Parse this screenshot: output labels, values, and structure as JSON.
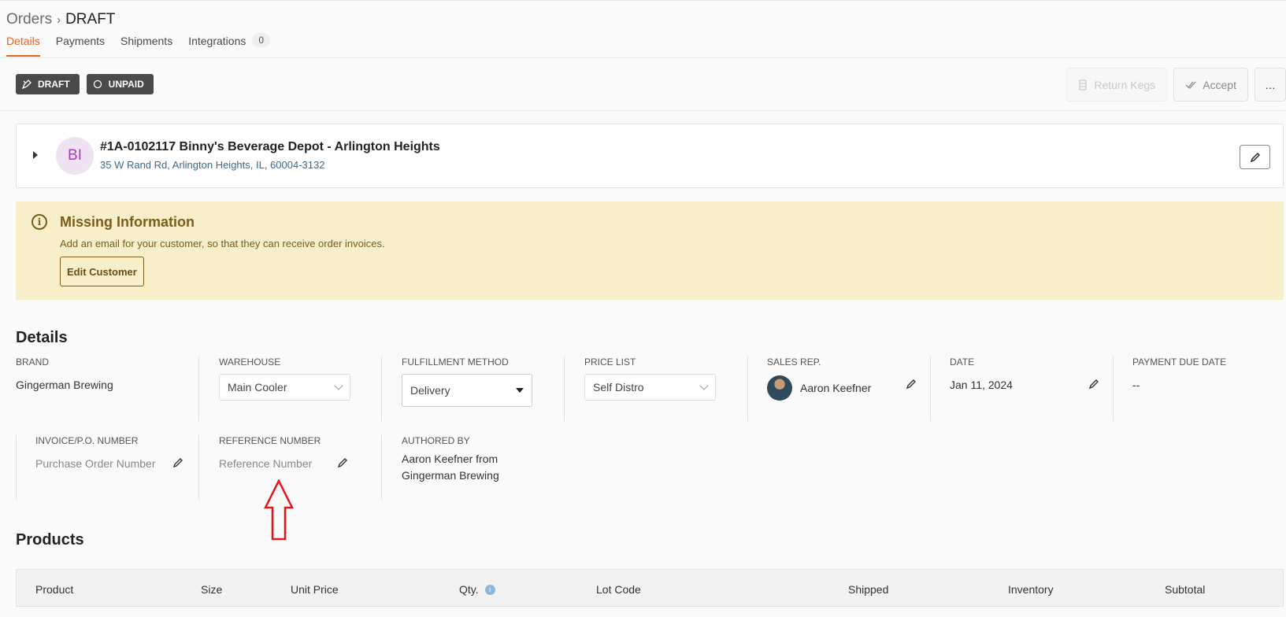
{
  "breadcrumb": {
    "parent": "Orders",
    "separator": "›",
    "current": "DRAFT"
  },
  "tabs": [
    {
      "label": "Details",
      "active": true
    },
    {
      "label": "Payments"
    },
    {
      "label": "Shipments"
    },
    {
      "label": "Integrations",
      "count": "0"
    }
  ],
  "status": {
    "draft": "DRAFT",
    "unpaid": "UNPAID"
  },
  "actions": {
    "return_kegs": "Return Kegs",
    "accept": "Accept",
    "more": "…"
  },
  "customer": {
    "initials": "BI",
    "name": "#1A-0102117 Binny's Beverage Depot - Arlington Heights",
    "address": "35 W Rand Rd, Arlington Heights, IL, 60004-3132"
  },
  "alert": {
    "title": "Missing Information",
    "text": "Add an email for your customer, so that they can receive order invoices.",
    "button": "Edit Customer"
  },
  "details": {
    "heading": "Details",
    "brand": {
      "label": "BRAND",
      "value": "Gingerman Brewing"
    },
    "warehouse": {
      "label": "WAREHOUSE",
      "value": "Main Cooler"
    },
    "fulfillment": {
      "label": "FULFILLMENT METHOD",
      "value": "Delivery"
    },
    "price_list": {
      "label": "PRICE LIST",
      "value": "Self Distro"
    },
    "sales_rep": {
      "label": "SALES REP.",
      "value": "Aaron Keefner"
    },
    "date": {
      "label": "DATE",
      "value": "Jan 11, 2024"
    },
    "payment_due": {
      "label": "PAYMENT DUE DATE",
      "value": "--"
    },
    "invoice": {
      "label": "INVOICE/P.O. NUMBER",
      "placeholder": "Purchase Order Number"
    },
    "reference": {
      "label": "REFERENCE NUMBER",
      "placeholder": "Reference Number"
    },
    "authored": {
      "label": "AUTHORED BY",
      "line1": "Aaron Keefner from",
      "line2": "Gingerman Brewing"
    }
  },
  "products": {
    "heading": "Products",
    "columns": [
      "Product",
      "Size",
      "Unit Price",
      "Qty.",
      "Lot Code",
      "Shipped",
      "Inventory",
      "Subtotal"
    ]
  },
  "colors": {
    "accent": "#e8641b",
    "alert_bg": "#f7efc9",
    "alert_text": "#7b5c1a",
    "badge_bg": "#4a4a4a",
    "annotation": "#e8141b"
  }
}
